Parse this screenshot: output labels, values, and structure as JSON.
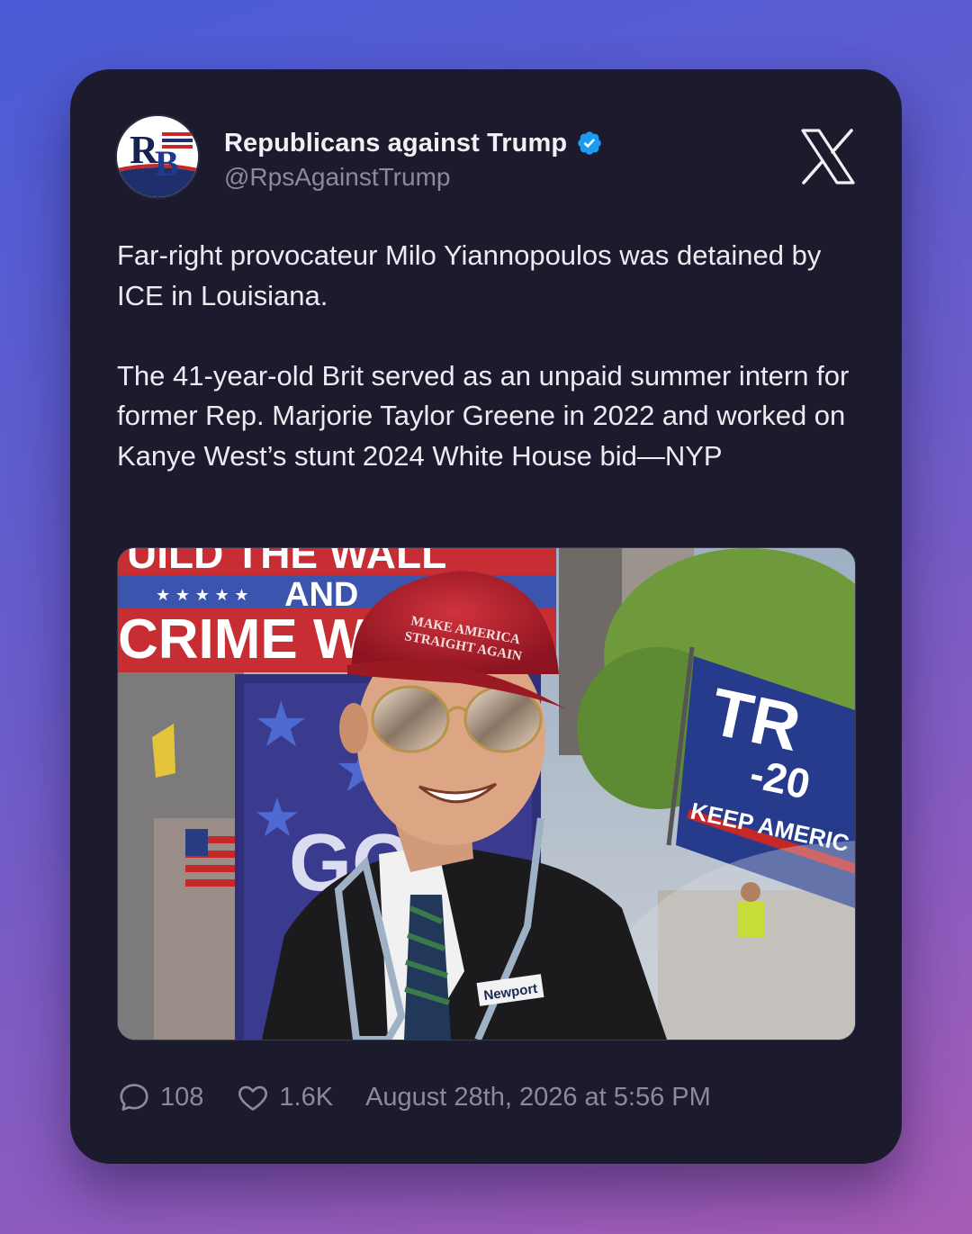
{
  "account": {
    "name": "Republicans against Trump",
    "handle": "@RpsAgainstTrump",
    "verified": true,
    "avatar_icon": "rb-logo-avatar",
    "avatar_text": "RB"
  },
  "platform_icon": "x-logo-icon",
  "tweet": {
    "paragraphs": [
      "Far-right provocateur Milo Yiannopoulos was detained by ICE in Louisiana.",
      "The 41-year-old Brit served as an unpaid summer intern for former Rep. Marjorie Taylor Greene in 2022 and worked on Kanye West’s stunt 2024 White House bid—NYP"
    ]
  },
  "photo": {
    "banner_top": "UILD THE WALL",
    "banner_and": "AND",
    "banner_bottom": "CRIME WI",
    "sign_letters": "GO",
    "cap_text_1": "MAKE AMERICA",
    "cap_text_2": "STRAIGHT AGAIN",
    "flag_text_1": "TR",
    "flag_text_2": "-20",
    "flag_text_3": "KEEP AMERIC",
    "badge_text": "Newport"
  },
  "stats": {
    "replies": "108",
    "likes": "1.6K",
    "timestamp": "August 28th, 2026 at 5:56 PM"
  },
  "colors": {
    "card_bg": "#1c1b2e",
    "text": "#ecebf2",
    "muted": "#8b8a9c",
    "verified_blue": "#1d9bf0"
  }
}
